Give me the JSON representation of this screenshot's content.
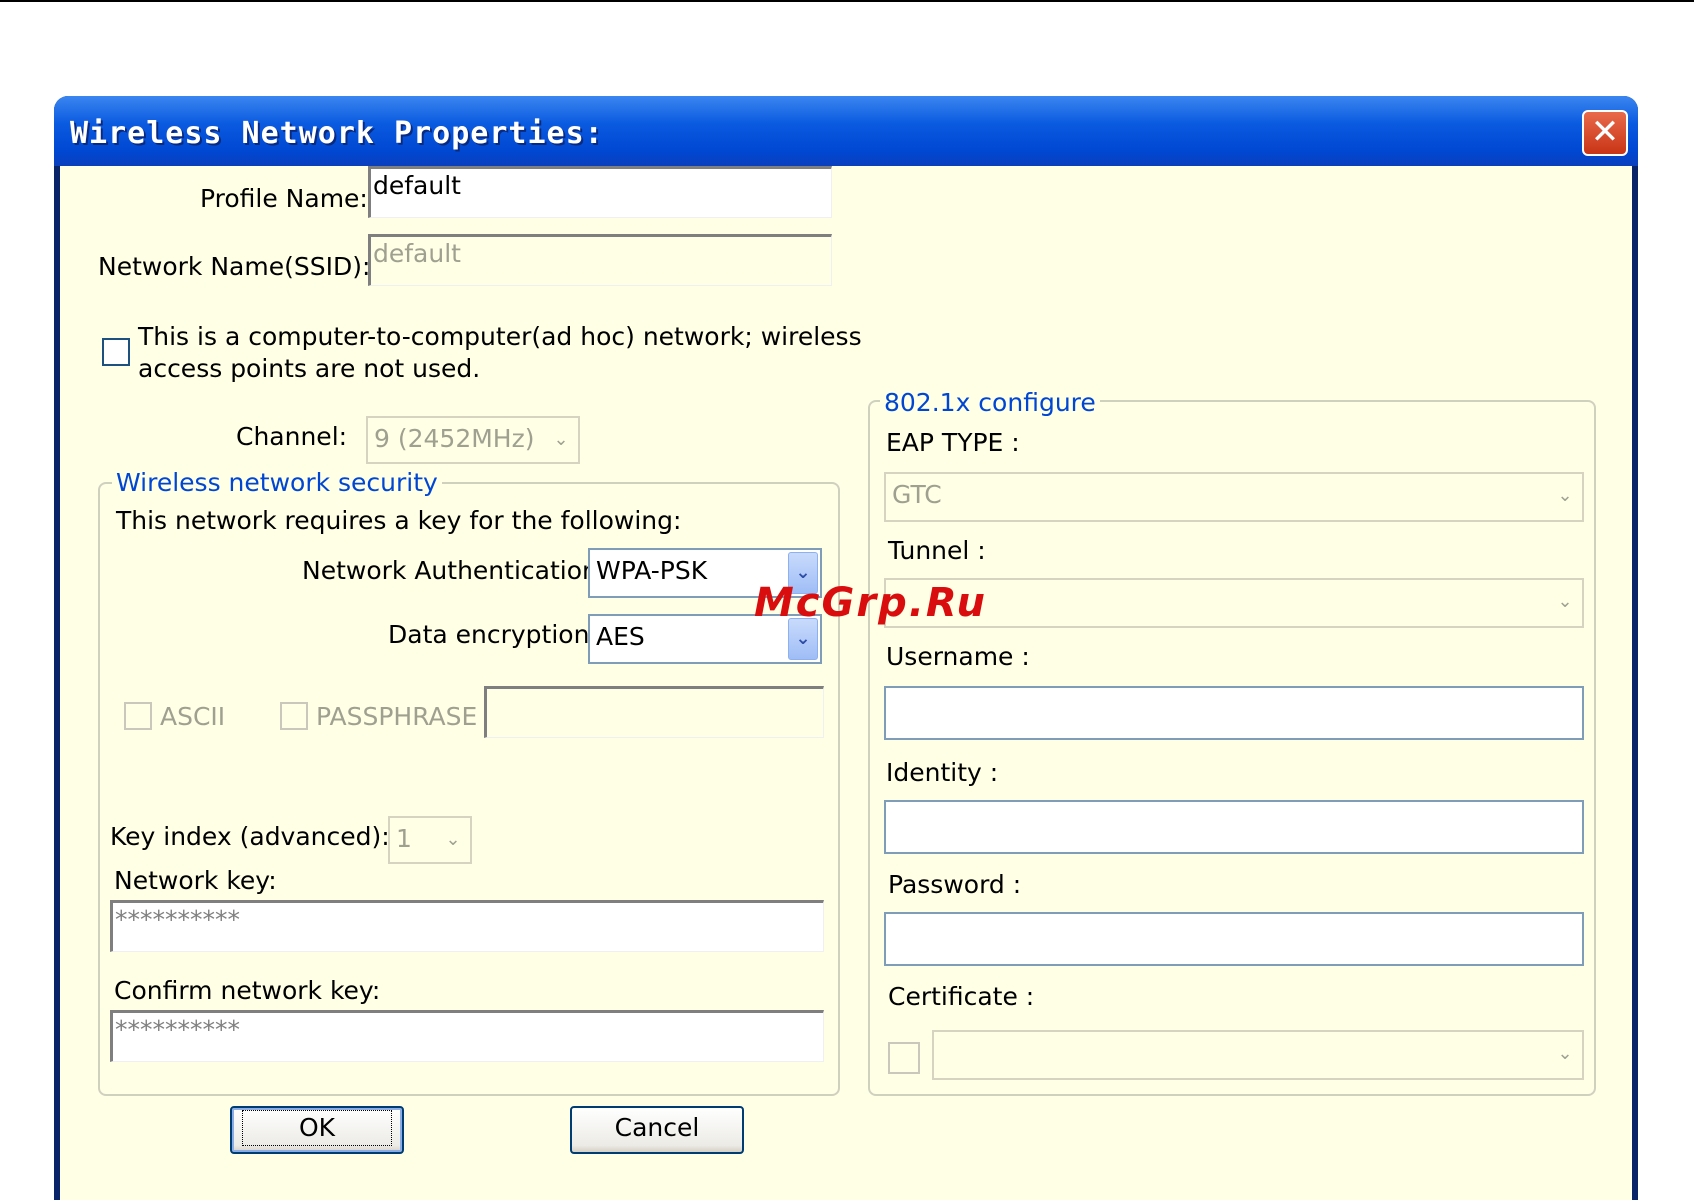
{
  "window": {
    "title": "Wireless Network Properties:",
    "close_glyph": "✕"
  },
  "profile": {
    "label": "Profile Name:",
    "value": "default"
  },
  "ssid": {
    "label": "Network Name(SSID):",
    "value": "default"
  },
  "adhoc": {
    "line1": "This is a computer-to-computer(ad hoc) network; wireless",
    "line2": "access points are not used.",
    "checked": false
  },
  "channel": {
    "label": "Channel:",
    "value": "9  (2452MHz)"
  },
  "security": {
    "legend": "Wireless network security",
    "requires_text": "This network requires a key for the following:",
    "auth_label": "Network Authentication:",
    "auth_value": "WPA-PSK",
    "enc_label": "Data encryption:",
    "enc_value": "AES",
    "ascii_label": "ASCII",
    "passphrase_label": "PASSPHRASE",
    "key_index_label": "Key index (advanced):",
    "key_index_value": "1",
    "network_key_label": "Network key:",
    "network_key_value": "**********",
    "confirm_key_label": "Confirm network key:",
    "confirm_key_value": "**********"
  },
  "eap": {
    "legend": "802.1x configure",
    "eap_type_label": "EAP TYPE :",
    "eap_type_value": "GTC",
    "tunnel_label": "Tunnel :",
    "tunnel_value": "",
    "username_label": "Username :",
    "identity_label": "Identity :",
    "password_label": "Password :",
    "certificate_label": "Certificate :"
  },
  "buttons": {
    "ok": "OK",
    "cancel": "Cancel"
  },
  "watermark": "McGrp.Ru",
  "colors": {
    "title_bar": "#0a5ae0",
    "client_bg": "#ffffe6",
    "group_label": "#0046d5",
    "watermark": "#d90d0d"
  }
}
